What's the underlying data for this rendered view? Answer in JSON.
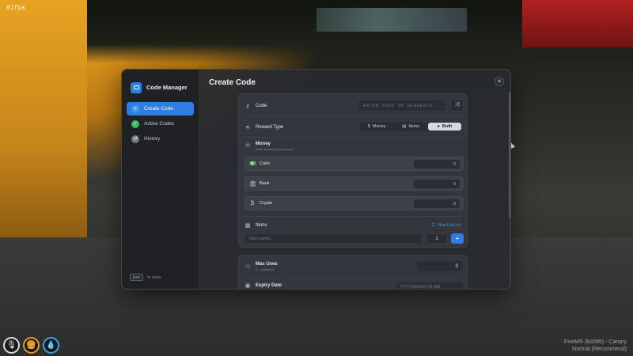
{
  "overlay": {
    "fps": "81fps",
    "watermark_line1": "FiveM® (b3095) - Canary",
    "watermark_line2": "Normal (Recommend)"
  },
  "hud": [
    {
      "icon": "microphone-icon",
      "glyph": "🎙"
    },
    {
      "icon": "food-icon",
      "glyph": "🍔"
    },
    {
      "icon": "water-drop-icon",
      "glyph": "💧"
    }
  ],
  "sidebar": {
    "title": "Code Manager",
    "items": [
      {
        "label": "Create Code",
        "icon": "plus-icon",
        "glyph": "+",
        "active": true
      },
      {
        "label": "Active Codes",
        "icon": "check-icon",
        "glyph": "✓",
        "active": false
      },
      {
        "label": "History",
        "icon": "history-icon",
        "glyph": "↺",
        "active": false
      }
    ],
    "esc_key": "ESC",
    "esc_text": "to close"
  },
  "main": {
    "title": "Create Code",
    "code": {
      "label": "Code",
      "placeholder": "ENTER CODE OR GENERATE..."
    },
    "reward_type": {
      "label": "Reward Type",
      "options": [
        {
          "label": "Money",
          "glyph": "$"
        },
        {
          "label": "Items",
          "glyph": "▤"
        },
        {
          "label": "Both",
          "glyph": "●"
        }
      ],
      "selected": "Both"
    },
    "money": {
      "title": "Money",
      "subtitle": "enter amounts per account",
      "accounts": [
        {
          "label": "Cash",
          "glyph": "💵",
          "value": "0"
        },
        {
          "label": "Bank",
          "glyph": "🏛",
          "value": "0"
        },
        {
          "label": "Crypto",
          "glyph": "₿",
          "value": "0"
        }
      ]
    },
    "items": {
      "label": "Items",
      "view_link": "View Full List",
      "name_placeholder": "Item name...",
      "quantity": "1",
      "add_glyph": "+"
    },
    "max_uses": {
      "title": "Max Uses",
      "subtitle": "0 = unlimited",
      "value": "0"
    },
    "expiry": {
      "title": "Expiry Date",
      "placeholder": "YYYY-MM-DD HH:MM"
    }
  },
  "colors": {
    "accent": "#2f7de0",
    "success": "#3bba55",
    "panel": "#282a30"
  }
}
